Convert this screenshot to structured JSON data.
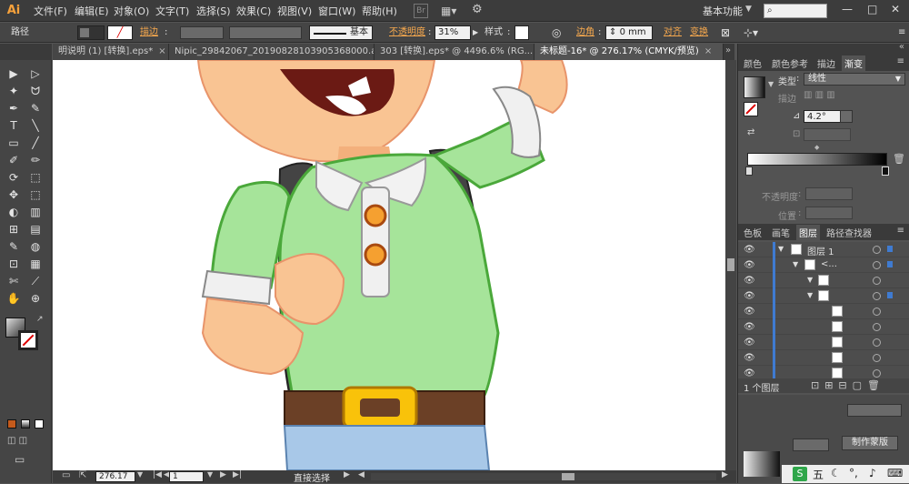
{
  "app": {
    "logo": "Ai",
    "workspace": "基本功能",
    "search_placeholder": ""
  },
  "menu": [
    "文件(F)",
    "编辑(E)",
    "对象(O)",
    "文字(T)",
    "选择(S)",
    "效果(C)",
    "视图(V)",
    "窗口(W)",
    "帮助(H)"
  ],
  "menu_icons": {
    "bridge": "Br",
    "arrange": "arrange-docs-icon",
    "gpu": "gpu-icon"
  },
  "window_buttons": [
    "—",
    "□",
    "✕"
  ],
  "control": {
    "selection": "路径",
    "stroke_label": "描边",
    "brush": "基本",
    "opacity_label": "不透明度",
    "opacity": "31%",
    "style_label": "样式",
    "corner_label": "边角",
    "corner_value": "0 mm",
    "align": "对齐",
    "transform": "变换"
  },
  "tabs": [
    {
      "label": "明说明 (1) [转换].eps*",
      "active": false
    },
    {
      "label": "Nipic_29842067_20190828103905368000.ai*",
      "active": false
    },
    {
      "label": "303 [转换].eps* @ 4496.6% (RG...",
      "active": false
    },
    {
      "label": "未标题-16* @ 276.17% (CMYK/预览)",
      "active": true
    }
  ],
  "tab_close": "×",
  "status": {
    "zoom": "276.17",
    "page": "1",
    "tool": "直接选择"
  },
  "panels": {
    "top_tabs": [
      "颜色",
      "颜色参考",
      "描边",
      "渐变"
    ],
    "gradient": {
      "type_label": "类型",
      "type_value": "线性",
      "stroke_label": "描边",
      "angle": "4.2°",
      "opacity_label": "不透明度",
      "position_label": "位置"
    },
    "mid_tabs": [
      "色板",
      "画笔",
      "图层",
      "路径查找器"
    ],
    "layers": [
      {
        "name": "图层 1",
        "indent": 0
      },
      {
        "name": "<...",
        "indent": 1
      },
      {
        "name": "",
        "indent": 2
      },
      {
        "name": "",
        "indent": 2
      },
      {
        "name": "",
        "indent": 3
      },
      {
        "name": "",
        "indent": 3
      },
      {
        "name": "",
        "indent": 3
      },
      {
        "name": "",
        "indent": 3
      },
      {
        "name": "",
        "indent": 3
      }
    ],
    "layer_count": "1 个图层",
    "make_mask": "制作蒙版"
  },
  "tools": [
    "▶",
    "▷",
    "✦",
    "ᗢ",
    "✒",
    "✎",
    "T",
    "╲",
    "▭",
    "╱",
    "✐",
    "✏",
    "⟳",
    "⬚",
    "✥",
    "⬚",
    "◐",
    "▥",
    "⊞",
    "▤",
    "✎",
    "◍",
    "⊡",
    "▦",
    "✄",
    "⟋",
    "✋",
    "⊕"
  ],
  "colors": {
    "accent": "#3f7bd1",
    "orange": "#f7a94e",
    "shirt": "#9ee08e",
    "skin": "#f9c493"
  }
}
